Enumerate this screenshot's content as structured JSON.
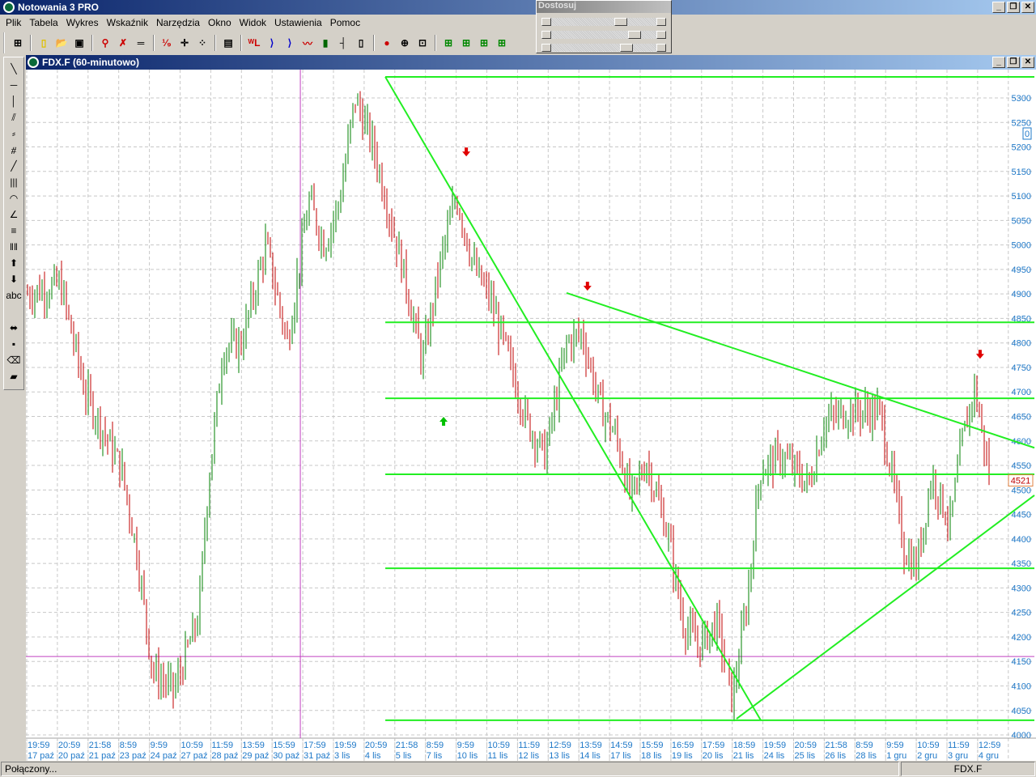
{
  "app": {
    "title": "Notowania 3 PRO"
  },
  "menu": [
    "Plik",
    "Tabela",
    "Wykres",
    "Wskaźnik",
    "Narzędzia",
    "Okno",
    "Widok",
    "Ustawienia",
    "Pomoc"
  ],
  "toolbar_icons": [
    "layout-icon",
    "new-file-icon",
    "open-folder-icon",
    "save-icon",
    "zoom-icon",
    "delete-icon",
    "ruler-icon",
    "numbers-icon",
    "crosshair-icon",
    "points-icon",
    "table-icon",
    "wl-icon",
    "fib-icon",
    "fib2-icon",
    "line-chart-icon",
    "bar-chart-icon",
    "ohlc-icon",
    "candle-icon",
    "signal-icon",
    "add-indicator-icon",
    "add-window-icon",
    "window-layout-1-icon",
    "window-layout-2-icon",
    "window-layout-3-icon",
    "window-layout-4-icon"
  ],
  "panel": {
    "title": "Dostosuj",
    "sliders": [
      0.78,
      0.95,
      0.85
    ]
  },
  "child_window": {
    "title": "FDX.F (60-minutowo)"
  },
  "drawing_tools": [
    "line-icon",
    "horizontal-line-icon",
    "vertical-line-icon",
    "parallel-lines-icon",
    "fan-icon",
    "gann-icon",
    "segment-icon",
    "vertical-lines-icon",
    "arcs-icon",
    "speed-lines-icon",
    "fib-retracement-icon",
    "time-zones-icon",
    "arrow-up-icon",
    "arrow-down-icon",
    "text-icon",
    "move-icon",
    "select-icon",
    "eraser-icon",
    "eraser-all-icon"
  ],
  "drawing_tool_text": "abc",
  "status": {
    "left": "Połączony...",
    "right": "FDX.F"
  },
  "colors": {
    "up": "#008000",
    "down": "#c00000",
    "trend": "#22ee22",
    "crosshair": "#c040c0",
    "axis_text": "#1e78c8"
  },
  "chart_data": {
    "type": "candlestick",
    "symbol": "FDX.F",
    "interval": "60-minutowo",
    "ylim": [
      4000,
      5300
    ],
    "yticks": [
      4000,
      4050,
      4100,
      4150,
      4200,
      4250,
      4300,
      4350,
      4400,
      4450,
      4500,
      4550,
      4600,
      4650,
      4700,
      4750,
      4800,
      4850,
      4900,
      4950,
      5000,
      5050,
      5100,
      5150,
      5200,
      5250,
      5300
    ],
    "last_price": "4521",
    "zero_marker": "0",
    "x_times": [
      "19:59",
      "20:59",
      "21:58",
      "8:59",
      "9:59",
      "10:59",
      "11:59",
      "13:59",
      "15:59",
      "17:59",
      "19:59",
      "20:59",
      "21:58",
      "8:59",
      "9:59",
      "10:59",
      "11:59",
      "12:59",
      "13:59",
      "14:59",
      "15:59",
      "16:59",
      "17:59",
      "18:59",
      "19:59",
      "20:59",
      "21:58",
      "8:59",
      "9:59",
      "10:59",
      "11:59",
      "12:59"
    ],
    "x_dates": [
      "17 paź",
      "20 paź",
      "21 paź",
      "23 paź",
      "24 paź",
      "27 paź",
      "28 paź",
      "29 paź",
      "30 paź",
      "31 paź",
      "3 lis",
      "4 lis",
      "5 lis",
      "7 lis",
      "10 lis",
      "11 lis",
      "12 lis",
      "13 lis",
      "14 lis",
      "17 lis",
      "18 lis",
      "19 lis",
      "20 lis",
      "21 lis",
      "24 lis",
      "25 lis",
      "26 lis",
      "28 lis",
      "1 gru",
      "2 gru",
      "3 gru",
      "4 gru"
    ],
    "price_path": [
      [
        0,
        4900
      ],
      [
        1.1,
        4920
      ],
      [
        1.9,
        4700
      ],
      [
        3.1,
        4540
      ],
      [
        3.6,
        4370
      ],
      [
        4.1,
        4130
      ],
      [
        4.8,
        4090
      ],
      [
        5.6,
        4240
      ],
      [
        5.9,
        4500
      ],
      [
        6.4,
        4790
      ],
      [
        7.0,
        4800
      ],
      [
        7.8,
        5000
      ],
      [
        8.5,
        4800
      ],
      [
        9.2,
        5090
      ],
      [
        9.7,
        5000
      ],
      [
        10.2,
        5090
      ],
      [
        10.7,
        5300
      ],
      [
        11.3,
        5200
      ],
      [
        11.8,
        5070
      ],
      [
        12.3,
        4940
      ],
      [
        12.9,
        4760
      ],
      [
        13.5,
        4970
      ],
      [
        14.0,
        5100
      ],
      [
        14.6,
        4950
      ],
      [
        15.1,
        4890
      ],
      [
        15.6,
        4790
      ],
      [
        16.3,
        4640
      ],
      [
        16.9,
        4570
      ],
      [
        17.6,
        4800
      ],
      [
        18.1,
        4820
      ],
      [
        18.7,
        4670
      ],
      [
        19.2,
        4610
      ],
      [
        19.7,
        4480
      ],
      [
        20.2,
        4560
      ],
      [
        20.9,
        4410
      ],
      [
        21.4,
        4230
      ],
      [
        21.9,
        4180
      ],
      [
        22.5,
        4230
      ],
      [
        23.0,
        4070
      ],
      [
        23.5,
        4280
      ],
      [
        23.9,
        4540
      ],
      [
        24.6,
        4570
      ],
      [
        25.5,
        4510
      ],
      [
        26.0,
        4640
      ],
      [
        26.8,
        4660
      ],
      [
        27.8,
        4660
      ],
      [
        28.2,
        4530
      ],
      [
        28.6,
        4380
      ],
      [
        29.0,
        4340
      ],
      [
        29.5,
        4530
      ],
      [
        30.1,
        4430
      ],
      [
        30.5,
        4600
      ],
      [
        30.9,
        4710
      ],
      [
        31.4,
        4521
      ]
    ],
    "trendlines": [
      {
        "from": [
          11.69,
          5343
        ],
        "to": [
          23.93,
          4030
        ]
      },
      {
        "from": [
          17.6,
          4902
        ],
        "to": [
          32.85,
          4586
        ]
      },
      {
        "from": [
          23.14,
          4033
        ],
        "to": [
          32.85,
          4489
        ]
      }
    ],
    "horizontal_levels": {
      "from_index": 11.69,
      "levels": [
        5343,
        4842,
        4687,
        4532,
        4340,
        4030
      ]
    },
    "arrows": [
      {
        "type": "sell",
        "at": [
          14.33,
          5189
        ]
      },
      {
        "type": "sell",
        "at": [
          18.28,
          4915
        ]
      },
      {
        "type": "sell",
        "at": [
          31.08,
          4776
        ]
      },
      {
        "type": "buy",
        "at": [
          13.59,
          4641
        ]
      }
    ],
    "crosshair": {
      "index": 8.92,
      "price": 4160
    }
  }
}
